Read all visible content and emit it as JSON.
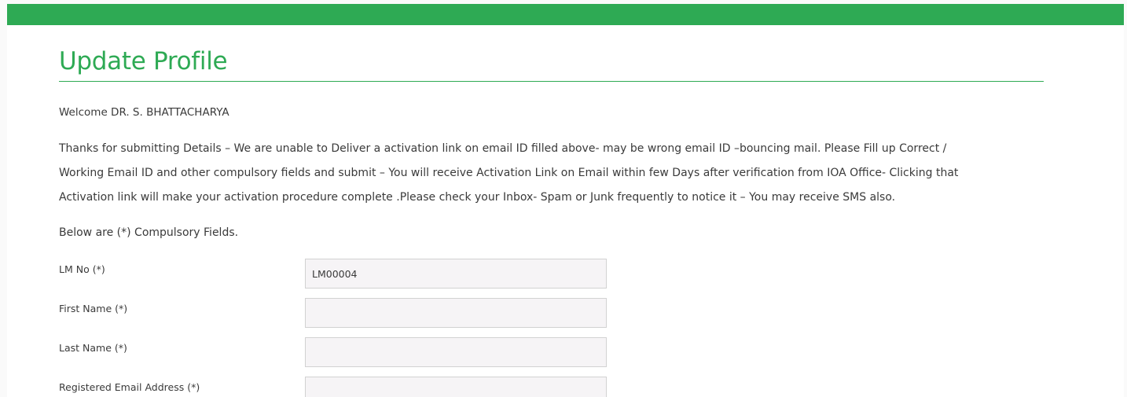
{
  "header": {
    "bar_color": "#2eaa54"
  },
  "page": {
    "title": "Update Profile",
    "welcome": "Welcome DR. S. BHATTACHARYA",
    "intro_lines": [
      "Thanks for submitting Details – We are unable to Deliver a activation link on email ID filled above- may be wrong email ID –bouncing mail. Please Fill up Correct /",
      "Working Email ID and other compulsory fields and submit – You will receive Activation Link on Email within few Days after verification from IOA Office- Clicking that",
      "Activation link will make your activation procedure complete .Please check your Inbox- Spam or Junk frequently to notice it – You may receive SMS also."
    ],
    "compulsory_note": "Below are (*) Compulsory Fields.",
    "accent_color": "#2eaa54"
  },
  "form": {
    "fields": [
      {
        "label": "LM No (*)",
        "value": "LM00004"
      },
      {
        "label": "First Name (*)",
        "value": ""
      },
      {
        "label": "Last Name (*)",
        "value": ""
      },
      {
        "label": "Registered Email Address (*)",
        "value": ""
      }
    ]
  }
}
